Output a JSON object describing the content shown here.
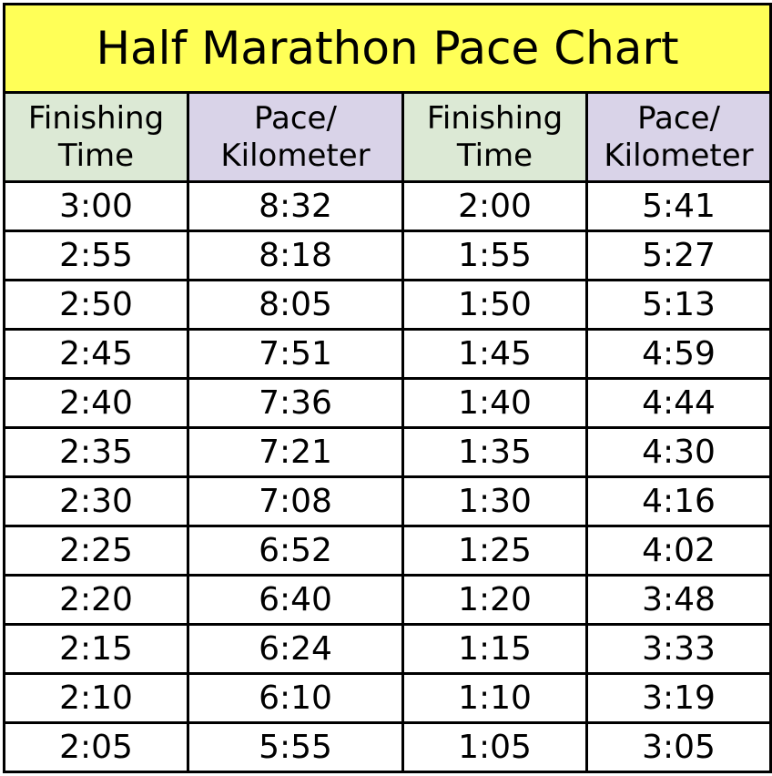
{
  "title": "Half Marathon Pace Chart",
  "colors": {
    "title_bg": "#ffff57",
    "finishing_time_header_bg": "#dce9d5",
    "pace_header_bg": "#d9d3e8",
    "border": "#000000"
  },
  "headers": [
    {
      "line1": "Finishing",
      "line2": "Time",
      "kind": "time"
    },
    {
      "line1": "Pace/",
      "line2": "Kilometer",
      "kind": "pace"
    },
    {
      "line1": "Finishing",
      "line2": "Time",
      "kind": "time"
    },
    {
      "line1": "Pace/",
      "line2": "Kilometer",
      "kind": "pace"
    }
  ],
  "rows": [
    [
      "3:00",
      "8:32",
      "2:00",
      "5:41"
    ],
    [
      "2:55",
      "8:18",
      "1:55",
      "5:27"
    ],
    [
      "2:50",
      "8:05",
      "1:50",
      "5:13"
    ],
    [
      "2:45",
      "7:51",
      "1:45",
      "4:59"
    ],
    [
      "2:40",
      "7:36",
      "1:40",
      "4:44"
    ],
    [
      "2:35",
      "7:21",
      "1:35",
      "4:30"
    ],
    [
      "2:30",
      "7:08",
      "1:30",
      "4:16"
    ],
    [
      "2:25",
      "6:52",
      "1:25",
      "4:02"
    ],
    [
      "2:20",
      "6:40",
      "1:20",
      "3:48"
    ],
    [
      "2:15",
      "6:24",
      "1:15",
      "3:33"
    ],
    [
      "2:10",
      "6:10",
      "1:10",
      "3:19"
    ],
    [
      "2:05",
      "5:55",
      "1:05",
      "3:05"
    ]
  ]
}
